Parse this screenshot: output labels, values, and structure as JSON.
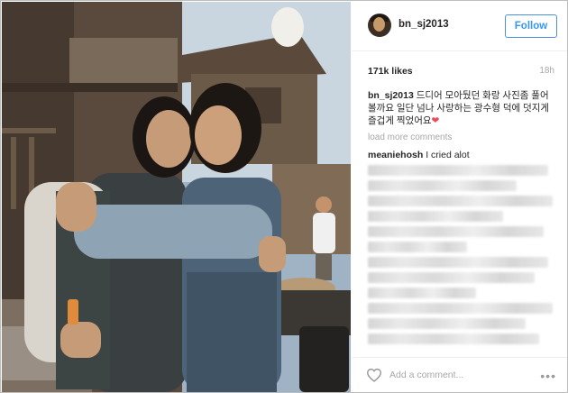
{
  "post": {
    "username": "bn_sj2013",
    "follow_label": "Follow",
    "likes": "171k likes",
    "time": "18h",
    "caption_user": "bn_sj2013",
    "caption_text": "드디어 모아뒀던 화랑 사진좀 풀어볼까요 일단 넘나 사랑하는 광수형 덕에 덧지게 즐겁게 찍었어요",
    "load_more": "load more comments",
    "comments": [
      {
        "user": "meaniehosh",
        "text": "I cried alot"
      }
    ],
    "add_comment_placeholder": "Add a comment...",
    "more_label": "•••"
  },
  "icons": {
    "heart": "heart-outline-icon",
    "more": "more-options-icon",
    "caption_heart": "heart-emoji-icon"
  },
  "colors": {
    "follow_blue": "#3897f0",
    "heart_red": "#ed4956",
    "muted": "#a5a7aa"
  }
}
